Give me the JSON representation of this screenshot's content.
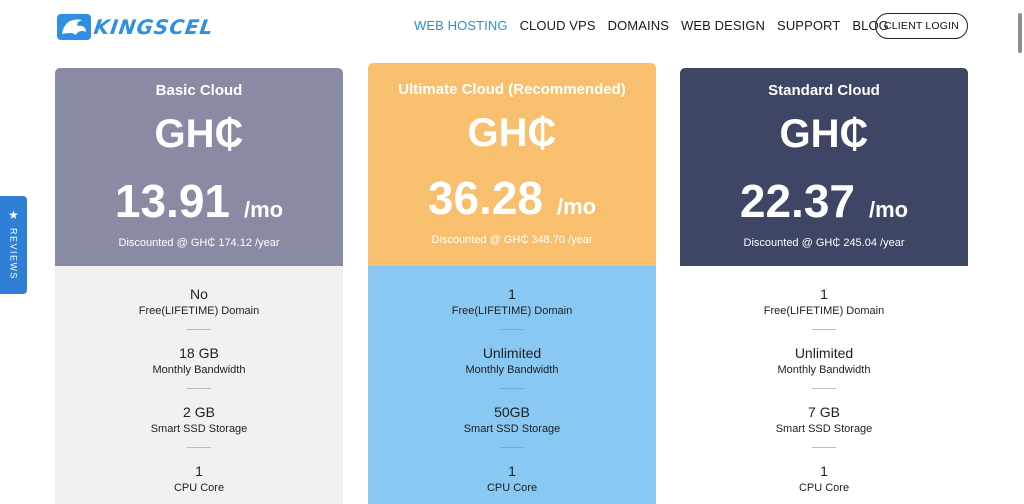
{
  "brand": {
    "name": "KINGSCEL",
    "color": "#2f8fe0"
  },
  "nav": {
    "items": [
      {
        "label": "WEB HOSTING",
        "active": true
      },
      {
        "label": "CLOUD VPS",
        "active": false
      },
      {
        "label": "DOMAINS",
        "active": false
      },
      {
        "label": "WEB DESIGN",
        "active": false
      },
      {
        "label": "SUPPORT",
        "active": false
      },
      {
        "label": "BLOG",
        "active": false
      }
    ],
    "login_label": "CLIENT LOGIN"
  },
  "reviews_tab": {
    "label": "REVIEWS",
    "icon": "star-icon",
    "color": "#2f7fd6"
  },
  "plans": [
    {
      "name": "Basic Cloud",
      "currency": "GH₵",
      "price": "13.91",
      "per": "/mo",
      "discount": "Discounted @ GH₵ 174.12 /year",
      "header_color": "#898aa4",
      "body_color": "#f1f1f1",
      "features": [
        {
          "value": "No",
          "label": "Free(LIFETIME) Domain"
        },
        {
          "value": "18 GB",
          "label": "Monthly Bandwidth"
        },
        {
          "value": "2 GB",
          "label": "Smart SSD Storage"
        },
        {
          "value": "1",
          "label": "CPU Core"
        }
      ]
    },
    {
      "name": "Ultimate Cloud (Recommended)",
      "currency": "GH₵",
      "price": "36.28",
      "per": "/mo",
      "discount": "Discounted @ GH₵ 348.70 /year",
      "header_color": "#f8c06e",
      "body_color": "#88c8f2",
      "features": [
        {
          "value": "1",
          "label": "Free(LIFETIME) Domain"
        },
        {
          "value": "Unlimited",
          "label": "Monthly Bandwidth"
        },
        {
          "value": "50GB",
          "label": "Smart SSD Storage"
        },
        {
          "value": "1",
          "label": "CPU Core"
        }
      ]
    },
    {
      "name": "Standard Cloud",
      "currency": "GH₵",
      "price": "22.37",
      "per": "/mo",
      "discount": "Discounted @ GH₵ 245.04 /year",
      "header_color": "#3e4565",
      "body_color": "#ffffff",
      "features": [
        {
          "value": "1",
          "label": "Free(LIFETIME) Domain"
        },
        {
          "value": "Unlimited",
          "label": "Monthly Bandwidth"
        },
        {
          "value": "7 GB",
          "label": "Smart SSD Storage"
        },
        {
          "value": "1",
          "label": "CPU Core"
        }
      ]
    }
  ]
}
